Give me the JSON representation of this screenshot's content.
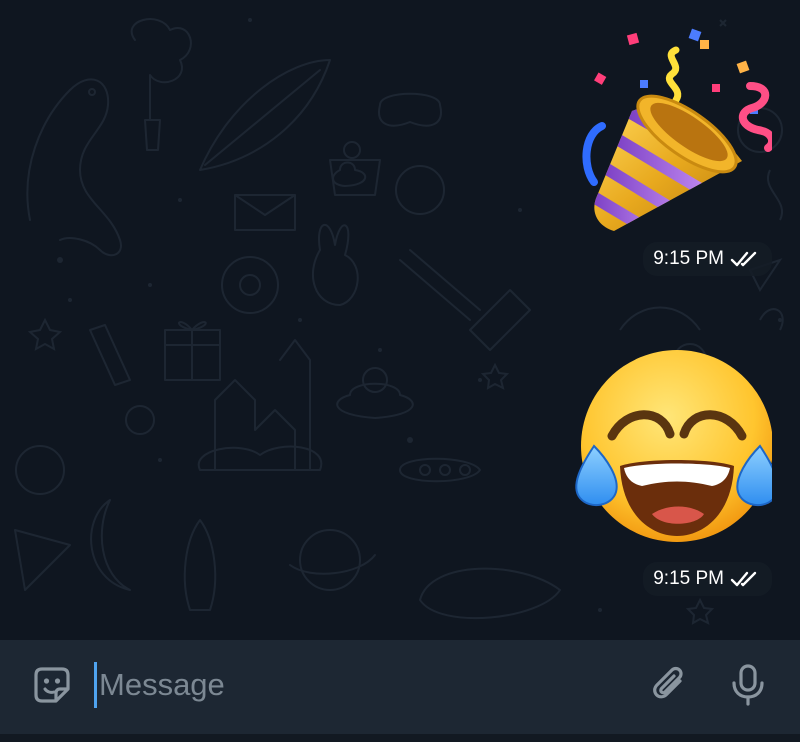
{
  "chat": {
    "messages": [
      {
        "sticker": "party-popper-sticker",
        "time": "9:15 PM",
        "status": "read-double-check-icon"
      },
      {
        "sticker": "tears-of-joy-sticker",
        "time": "9:15 PM",
        "status": "read-double-check-icon"
      }
    ]
  },
  "composer": {
    "placeholder": "Message",
    "left_icon": "sticker-icon",
    "attach_icon": "paperclip-icon",
    "mic_icon": "microphone-icon"
  },
  "colors": {
    "background": "#0f1620",
    "input_bar": "#1d2733",
    "caret": "#4fa3ef",
    "placeholder": "#7c8893"
  }
}
